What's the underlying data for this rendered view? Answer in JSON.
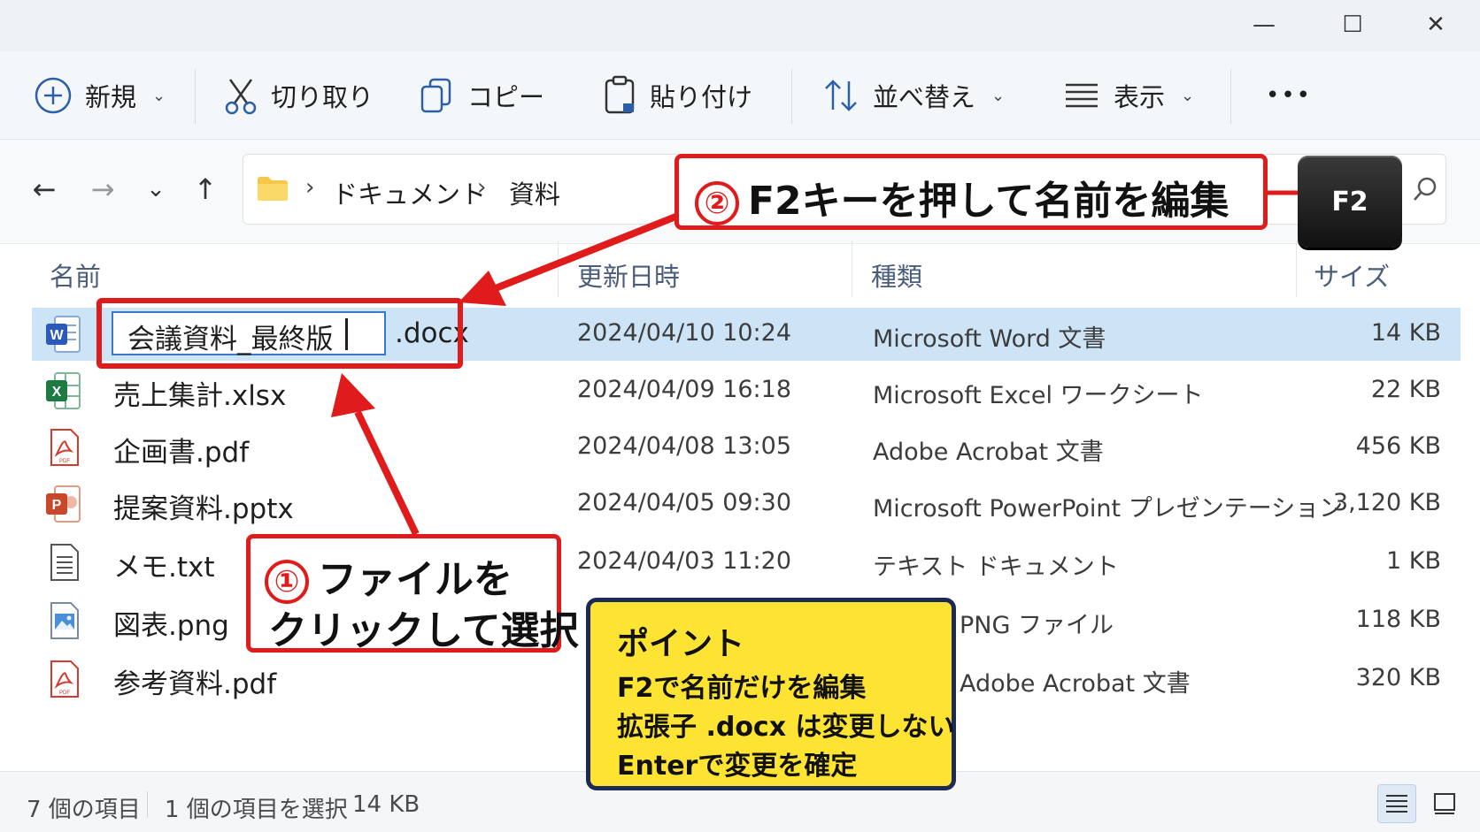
{
  "window": {
    "minimize_glyph": "—",
    "maximize_glyph": "☐",
    "close_glyph": "✕"
  },
  "toolbar": {
    "new_label": "新規",
    "cut_label": "切り取り",
    "copy_label": "コピー",
    "paste_label": "貼り付け",
    "sort_label": "並べ替え",
    "view_label": "表示",
    "more_label": "•••"
  },
  "nav": {
    "back": "←",
    "forward": "→",
    "recent": "⌄",
    "up": "↑"
  },
  "breadcrumb": {
    "items": [
      "ドキュメント",
      "資料"
    ],
    "separator": "›"
  },
  "columns": {
    "name": "名前",
    "modified": "更新日時",
    "type": "種類",
    "size": "サイズ"
  },
  "files": [
    {
      "name": "会議資料_最終版",
      "ext": ".docx",
      "modified": "2024/04/10 10:24",
      "type": "Microsoft Word 文書",
      "size": "14 KB",
      "icon": "word-icon",
      "selected": true,
      "renaming": true
    },
    {
      "name": "売上集計.xlsx",
      "modified": "2024/04/09 16:18",
      "type": "Microsoft Excel ワークシート",
      "size": "22 KB",
      "icon": "excel-icon"
    },
    {
      "name": "企画書.pdf",
      "modified": "2024/04/08 13:05",
      "type": "Adobe Acrobat 文書",
      "size": "456 KB",
      "icon": "pdf-icon"
    },
    {
      "name": "提案資料.pptx",
      "modified": "2024/04/05 09:30",
      "type": "Microsoft PowerPoint プレゼンテーション",
      "size": "3,120 KB",
      "icon": "powerpoint-icon"
    },
    {
      "name": "メモ.txt",
      "modified": "2024/04/03 11:20",
      "type": "テキスト ドキュメント",
      "size": "1 KB",
      "icon": "text-file-icon"
    },
    {
      "name": "図表.png",
      "modified": "",
      "type": "PNG ファイル",
      "size": "118 KB",
      "icon": "image-file-icon"
    },
    {
      "name": "参考資料.pdf",
      "modified": "",
      "type": "Adobe Acrobat 文書",
      "size": "320 KB",
      "icon": "pdf-icon"
    }
  ],
  "status": {
    "count": "7 個の項目",
    "selection": "1 個の項目を選択",
    "size": "14 KB"
  },
  "annotations": {
    "step1_number": "①",
    "step1_line1": "ファイルを",
    "step1_line2": "クリックして選択",
    "step2_number": "②",
    "step2_text": "F2キーを押して名前を編集",
    "key_label": "F2",
    "point_title": "ポイント",
    "point_lines": [
      "F2で名前だけを編集",
      "拡張子 .docx は変更しない",
      "Enterで変更を確定"
    ]
  },
  "colors": {
    "accent_red": "#e01b1b",
    "selection": "#cde4f7",
    "point_bg": "#fde332",
    "point_border": "#1c2a57"
  }
}
